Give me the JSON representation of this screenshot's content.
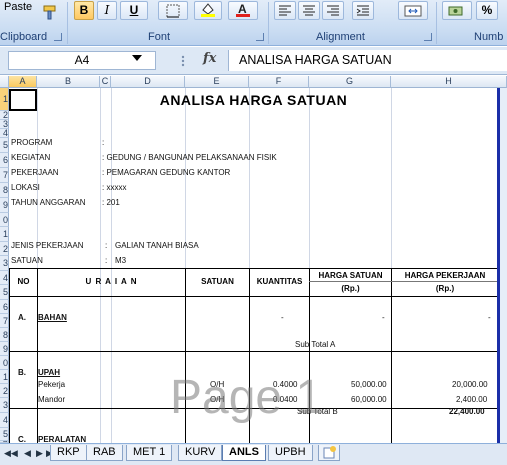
{
  "ribbon": {
    "paste_label": "Paste",
    "clipboard_group": "Clipboard",
    "font_group": "Font",
    "alignment_group": "Alignment",
    "number_group": "Numb",
    "bold_label": "B",
    "italic_label": "I",
    "underline_label": "U",
    "percent_label": "%"
  },
  "formula_bar": {
    "name_box": "A4",
    "fx_label": "fx",
    "formula": "ANALISA HARGA SATUAN"
  },
  "columns": [
    "A",
    "B",
    "C",
    "D",
    "E",
    "F",
    "G",
    "H"
  ],
  "rows": [
    "1",
    "2",
    "3",
    "4",
    "5",
    "6",
    "7",
    "8",
    "9",
    "0",
    "1",
    "2",
    "3",
    "4",
    "5",
    "6",
    "7",
    "8",
    "9",
    "0",
    "1",
    "2",
    "3",
    "4",
    "5",
    "6",
    "7"
  ],
  "sheet": {
    "title": "ANALISA HARGA SATUAN",
    "program_label": "PROGRAM",
    "program_value": ":",
    "kegiatan_label": "KEGIATAN",
    "kegiatan_value": ": GEDUNG / BANGUNAN PELAKSANAAN FISIK",
    "pekerjaan_label": "PEKERJAAN",
    "pekerjaan_value": ": PEMAGARAN GEDUNG KANTOR",
    "lokasi_label": "LOKASI",
    "lokasi_value": ": xxxxx",
    "tahun_label": "TAHUN ANGGARAN",
    "tahun_value": ": 201",
    "jenis_label": "JENIS PEKERJAAN",
    "jenis_colon": ":",
    "jenis_value": "GALIAN TANAH BIASA",
    "satuan_label": "SATUAN",
    "satuan_colon": ":",
    "satuan_value": "M3",
    "headers": {
      "no": "NO",
      "uraian": "U R A I A N",
      "satuan": "SATUAN",
      "kuantitas": "KUANTITAS",
      "harga_satuan": "HARGA SATUAN",
      "harga_satuan_unit": "(Rp.)",
      "harga_pekerjaan": "HARGA PEKERJAAN",
      "harga_pekerjaan_unit": "(Rp.)"
    },
    "section_a_no": "A.",
    "section_a": "BAHAN",
    "dash1": "-",
    "dash2": "-",
    "dash3": "-",
    "subtotal_a": "Sub Total  A",
    "section_b_no": "B.",
    "section_b": "UPAH",
    "upah": [
      {
        "name": "Pekerja",
        "unit": "O/H",
        "qty": "0.4000",
        "price": "50,000.00",
        "total": "20,000.00"
      },
      {
        "name": "Mandor",
        "unit": "O/H",
        "qty": "0.0400",
        "price": "60,000.00",
        "total": "2,400.00"
      }
    ],
    "subtotal_b": "Sub Total  B",
    "subtotal_b_value": "22,400.00",
    "section_c_no": "C.",
    "section_c": "PERALATAN",
    "watermark": "Page 1"
  },
  "tabs": [
    "RKP",
    "RAB",
    "MET 1",
    "KURV",
    "ANLS",
    "UPBH"
  ],
  "active_tab": "ANLS"
}
